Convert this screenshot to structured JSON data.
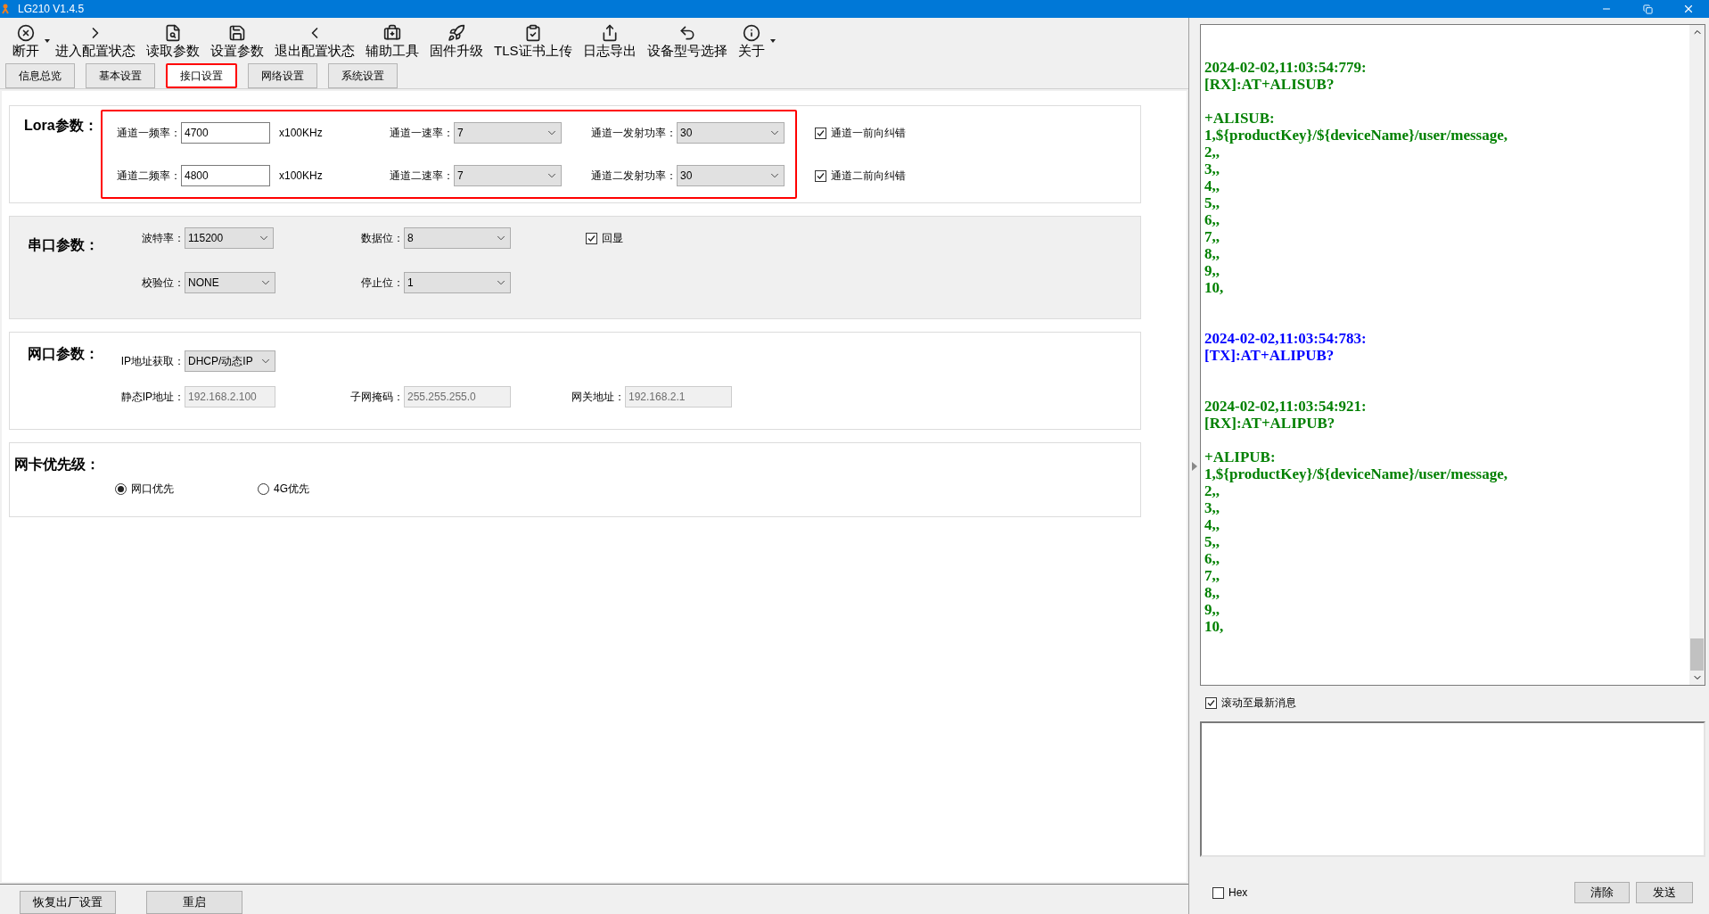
{
  "window": {
    "title": "LG210 V1.4.5"
  },
  "toolbar": [
    {
      "label": "断开",
      "dropdown": true
    },
    {
      "label": "进入配置状态",
      "dropdown": false
    },
    {
      "label": "读取参数",
      "dropdown": false
    },
    {
      "label": "设置参数",
      "dropdown": false
    },
    {
      "label": "退出配置状态",
      "dropdown": false
    },
    {
      "label": "辅助工具",
      "dropdown": false
    },
    {
      "label": "固件升级",
      "dropdown": false
    },
    {
      "label": "TLS证书上传",
      "dropdown": false
    },
    {
      "label": "日志导出",
      "dropdown": false
    },
    {
      "label": "设备型号选择",
      "dropdown": false
    },
    {
      "label": "关于",
      "dropdown": true
    }
  ],
  "tabs": [
    {
      "label": "信息总览",
      "selected": false,
      "highlighted": false
    },
    {
      "label": "基本设置",
      "selected": false,
      "highlighted": false
    },
    {
      "label": "接口设置",
      "selected": true,
      "highlighted": true
    },
    {
      "label": "网络设置",
      "selected": false,
      "highlighted": false
    },
    {
      "label": "系统设置",
      "selected": false,
      "highlighted": false
    }
  ],
  "lora": {
    "title": "Lora参数：",
    "highlighted": true,
    "rows": [
      {
        "freq_label": "通道一频率：",
        "freq": "4700",
        "unit": "x100KHz",
        "rate_label": "通道一速率：",
        "rate": "7",
        "power_label": "通道一发射功率：",
        "power": "30",
        "fec_label": "通道一前向纠错",
        "fec_checked": true
      },
      {
        "freq_label": "通道二频率：",
        "freq": "4800",
        "unit": "x100KHz",
        "rate_label": "通道二速率：",
        "rate": "7",
        "power_label": "通道二发射功率：",
        "power": "30",
        "fec_label": "通道二前向纠错",
        "fec_checked": true
      }
    ]
  },
  "serial": {
    "title": "串口参数：",
    "baud_label": "波特率：",
    "baud": "115200",
    "data_label": "数据位：",
    "data": "8",
    "echo_label": "回显",
    "echo_checked": true,
    "parity_label": "校验位：",
    "parity": "NONE",
    "stop_label": "停止位：",
    "stop": "1"
  },
  "ethernet": {
    "title": "网口参数：",
    "ip_mode_label": "IP地址获取：",
    "ip_mode": "DHCP/动态IP",
    "static_ip_label": "静态IP地址：",
    "static_ip": "192.168.2.100",
    "mask_label": "子网掩码：",
    "mask": "255.255.255.0",
    "gateway_label": "网关地址：",
    "gateway": "192.168.2.1"
  },
  "priority": {
    "title": "网卡优先级：",
    "options": [
      {
        "label": "网口优先",
        "selected": true
      },
      {
        "label": "4G优先",
        "selected": false
      }
    ]
  },
  "bottom_buttons": [
    "恢复出厂设置",
    "重启"
  ],
  "log": [
    {
      "kind": "rx",
      "header": [
        "2024-02-02,11:03:54:779:",
        "[RX]:AT+ALISUB?"
      ],
      "body": [
        "+ALISUB:",
        "1,${productKey}/${deviceName}/user/message,",
        "2,,",
        "3,,",
        "4,,",
        "5,,",
        "6,,",
        "7,,",
        "8,,",
        "9,,",
        "10,"
      ]
    },
    {
      "kind": "tx",
      "header": [
        "2024-02-02,11:03:54:783:",
        "[TX]:AT+ALIPUB?"
      ]
    },
    {
      "kind": "rx",
      "header": [
        "2024-02-02,11:03:54:921:",
        "[RX]:AT+ALIPUB?"
      ],
      "body": [
        "+ALIPUB:",
        "1,${productKey}/${deviceName}/user/message,",
        "2,,",
        "3,,",
        "4,,",
        "5,,",
        "6,,",
        "7,,",
        "8,,",
        "9,,",
        "10,"
      ]
    }
  ],
  "autoscroll": {
    "label": "滚动至最新消息",
    "checked": true
  },
  "hex": {
    "label": "Hex",
    "checked": false
  },
  "send_buttons": [
    "清除",
    "发送"
  ]
}
